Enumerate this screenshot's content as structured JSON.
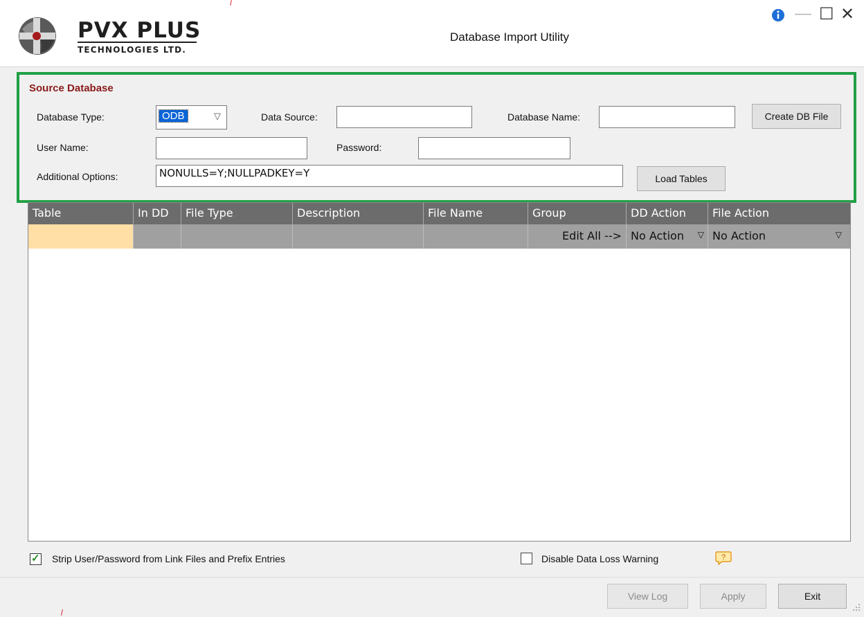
{
  "window": {
    "title": "Database Import Utility",
    "logo_main": "PVX PLUS",
    "logo_sub": "TECHNOLOGIES LTD.",
    "info_icon": "info-icon",
    "minimize_glyph": "—",
    "maximize_glyph": "☐",
    "close_glyph": "✕"
  },
  "source": {
    "title": "Source Database",
    "db_type_label": "Database Type:",
    "db_type_value": "ODB",
    "data_source_label": "Data Source:",
    "data_source_value": "",
    "db_name_label": "Database Name:",
    "db_name_value": "",
    "create_db_button": "Create DB File",
    "user_name_label": "User Name:",
    "user_name_value": "",
    "password_label": "Password:",
    "password_value": "",
    "additional_options_label": "Additional Options:",
    "additional_options_value": "NONULLS=Y;NULLPADKEY=Y",
    "load_tables_button": "Load Tables"
  },
  "grid": {
    "columns": [
      "Table",
      "In DD",
      "File Type",
      "Description",
      "File Name",
      "Group",
      "DD Action",
      "File Action"
    ],
    "row": {
      "table": "",
      "in_dd": "",
      "file_type": "",
      "description": "",
      "file_name": "",
      "group": "Edit All -->",
      "dd_action": "No Action",
      "file_action": "No Action"
    },
    "highlight_color": "#ffdfa6",
    "header_color": "#6c6c6c"
  },
  "options": {
    "strip_label": "Strip User/Password from Link Files and Prefix Entries",
    "strip_checked": true,
    "disable_warning_label": "Disable Data Loss Warning",
    "disable_warning_checked": false
  },
  "footer": {
    "view_log_button": "View Log",
    "apply_button": "Apply",
    "exit_button": "Exit"
  },
  "colors": {
    "section_border": "#21a045",
    "section_title": "#8b1a1a",
    "selection": "#0a64d8"
  }
}
